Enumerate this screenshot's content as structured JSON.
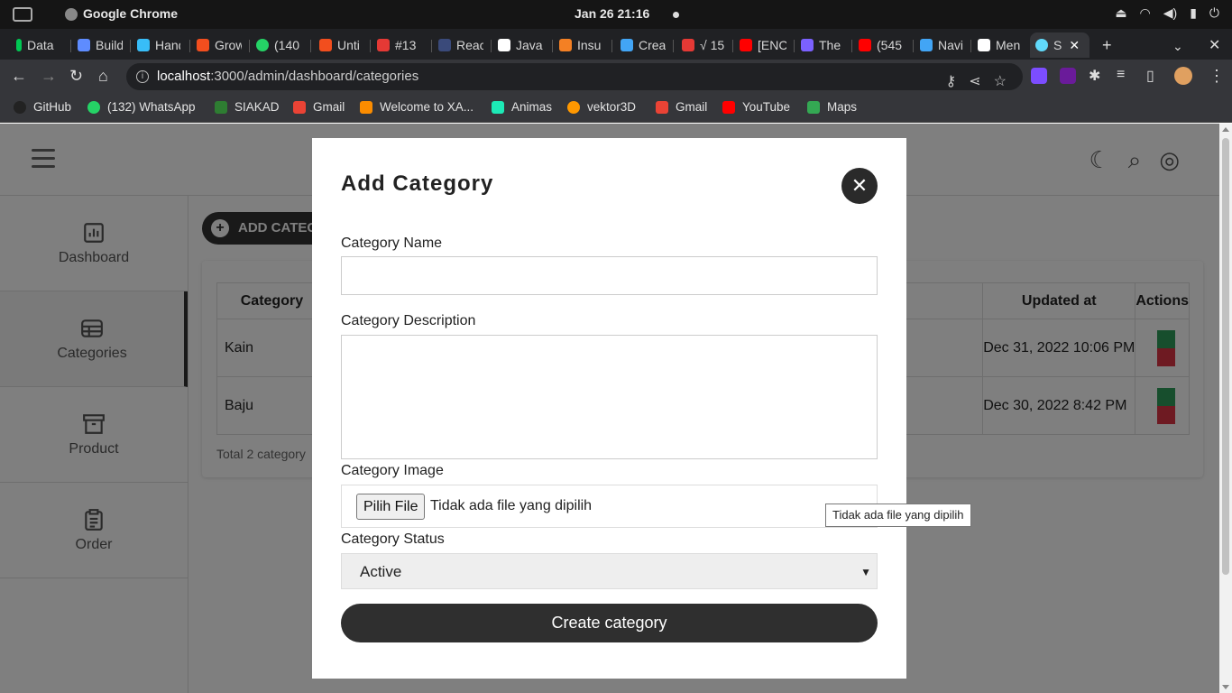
{
  "os": {
    "app_name": "Google Chrome",
    "clock": "Jan 26  21:16"
  },
  "browser": {
    "tabs": [
      {
        "label": "Data",
        "color": "#00c853"
      },
      {
        "label": "Build",
        "color": "#5e8cff"
      },
      {
        "label": "Hand",
        "color": "#38bdf8"
      },
      {
        "label": "Grow",
        "color": "#f24e1e"
      },
      {
        "label": "(140",
        "color": "#25d366"
      },
      {
        "label": "Unti",
        "color": "#f24e1e"
      },
      {
        "label": "#13",
        "color": "#e53935"
      },
      {
        "label": "Reac",
        "color": "#3a4a7a"
      },
      {
        "label": "Java",
        "color": "#ffffff"
      },
      {
        "label": "Insu",
        "color": "#f48024"
      },
      {
        "label": "Crea",
        "color": "#42a5f5"
      },
      {
        "label": "√ 15",
        "color": "#e53935"
      },
      {
        "label": "[ENC",
        "color": "#ff0000"
      },
      {
        "label": "The",
        "color": "#7b61ff"
      },
      {
        "label": "(545",
        "color": "#ff0000"
      },
      {
        "label": "Navi",
        "color": "#42a5f5"
      },
      {
        "label": "Men",
        "color": "#ffffff"
      },
      {
        "label": "S",
        "color": "#61dafb"
      }
    ],
    "url_host": "localhost",
    "url_path": ":3000/admin/dashboard/categories",
    "bookmarks": [
      {
        "label": "GitHub",
        "color": "#222"
      },
      {
        "label": "(132) WhatsApp",
        "color": "#25d366"
      },
      {
        "label": "SIAKAD",
        "color": "#2e7d32"
      },
      {
        "label": "Gmail",
        "color": "#ea4335"
      },
      {
        "label": "Welcome to XA...",
        "color": "#fb8c00"
      },
      {
        "label": "Animas",
        "color": "#1de9b6"
      },
      {
        "label": "vektor3D",
        "color": "#ff9800"
      },
      {
        "label": "Gmail",
        "color": "#ea4335"
      },
      {
        "label": "YouTube",
        "color": "#ff0000"
      },
      {
        "label": "Maps",
        "color": "#34a853"
      }
    ]
  },
  "sidebar": {
    "items": [
      {
        "label": "Dashboard",
        "icon": "bar-chart-icon"
      },
      {
        "label": "Categories",
        "icon": "table-icon"
      },
      {
        "label": "Product",
        "icon": "archive-icon"
      },
      {
        "label": "Order",
        "icon": "clipboard-icon"
      }
    ],
    "active": "Categories"
  },
  "main": {
    "add_button": "ADD CATEGORY",
    "table": {
      "headers": [
        "Category",
        "Updated at",
        "Actions"
      ],
      "rows": [
        {
          "name": "Kain",
          "updated": "Dec 31, 2022 10:06 PM"
        },
        {
          "name": "Baju",
          "updated": "Dec 30, 2022 8:42 PM"
        }
      ]
    },
    "total": "Total 2 category"
  },
  "modal": {
    "title": "Add Category",
    "name_label": "Category Name",
    "name_value": "",
    "description_label": "Category Description",
    "description_value": "",
    "image_label": "Category Image",
    "file_button": "Pilih File",
    "file_status": "Tidak ada file yang dipilih",
    "status_label": "Category Status",
    "status_value": "Active",
    "submit_label": "Create category"
  },
  "tooltip": "Tidak ada file yang dipilih"
}
